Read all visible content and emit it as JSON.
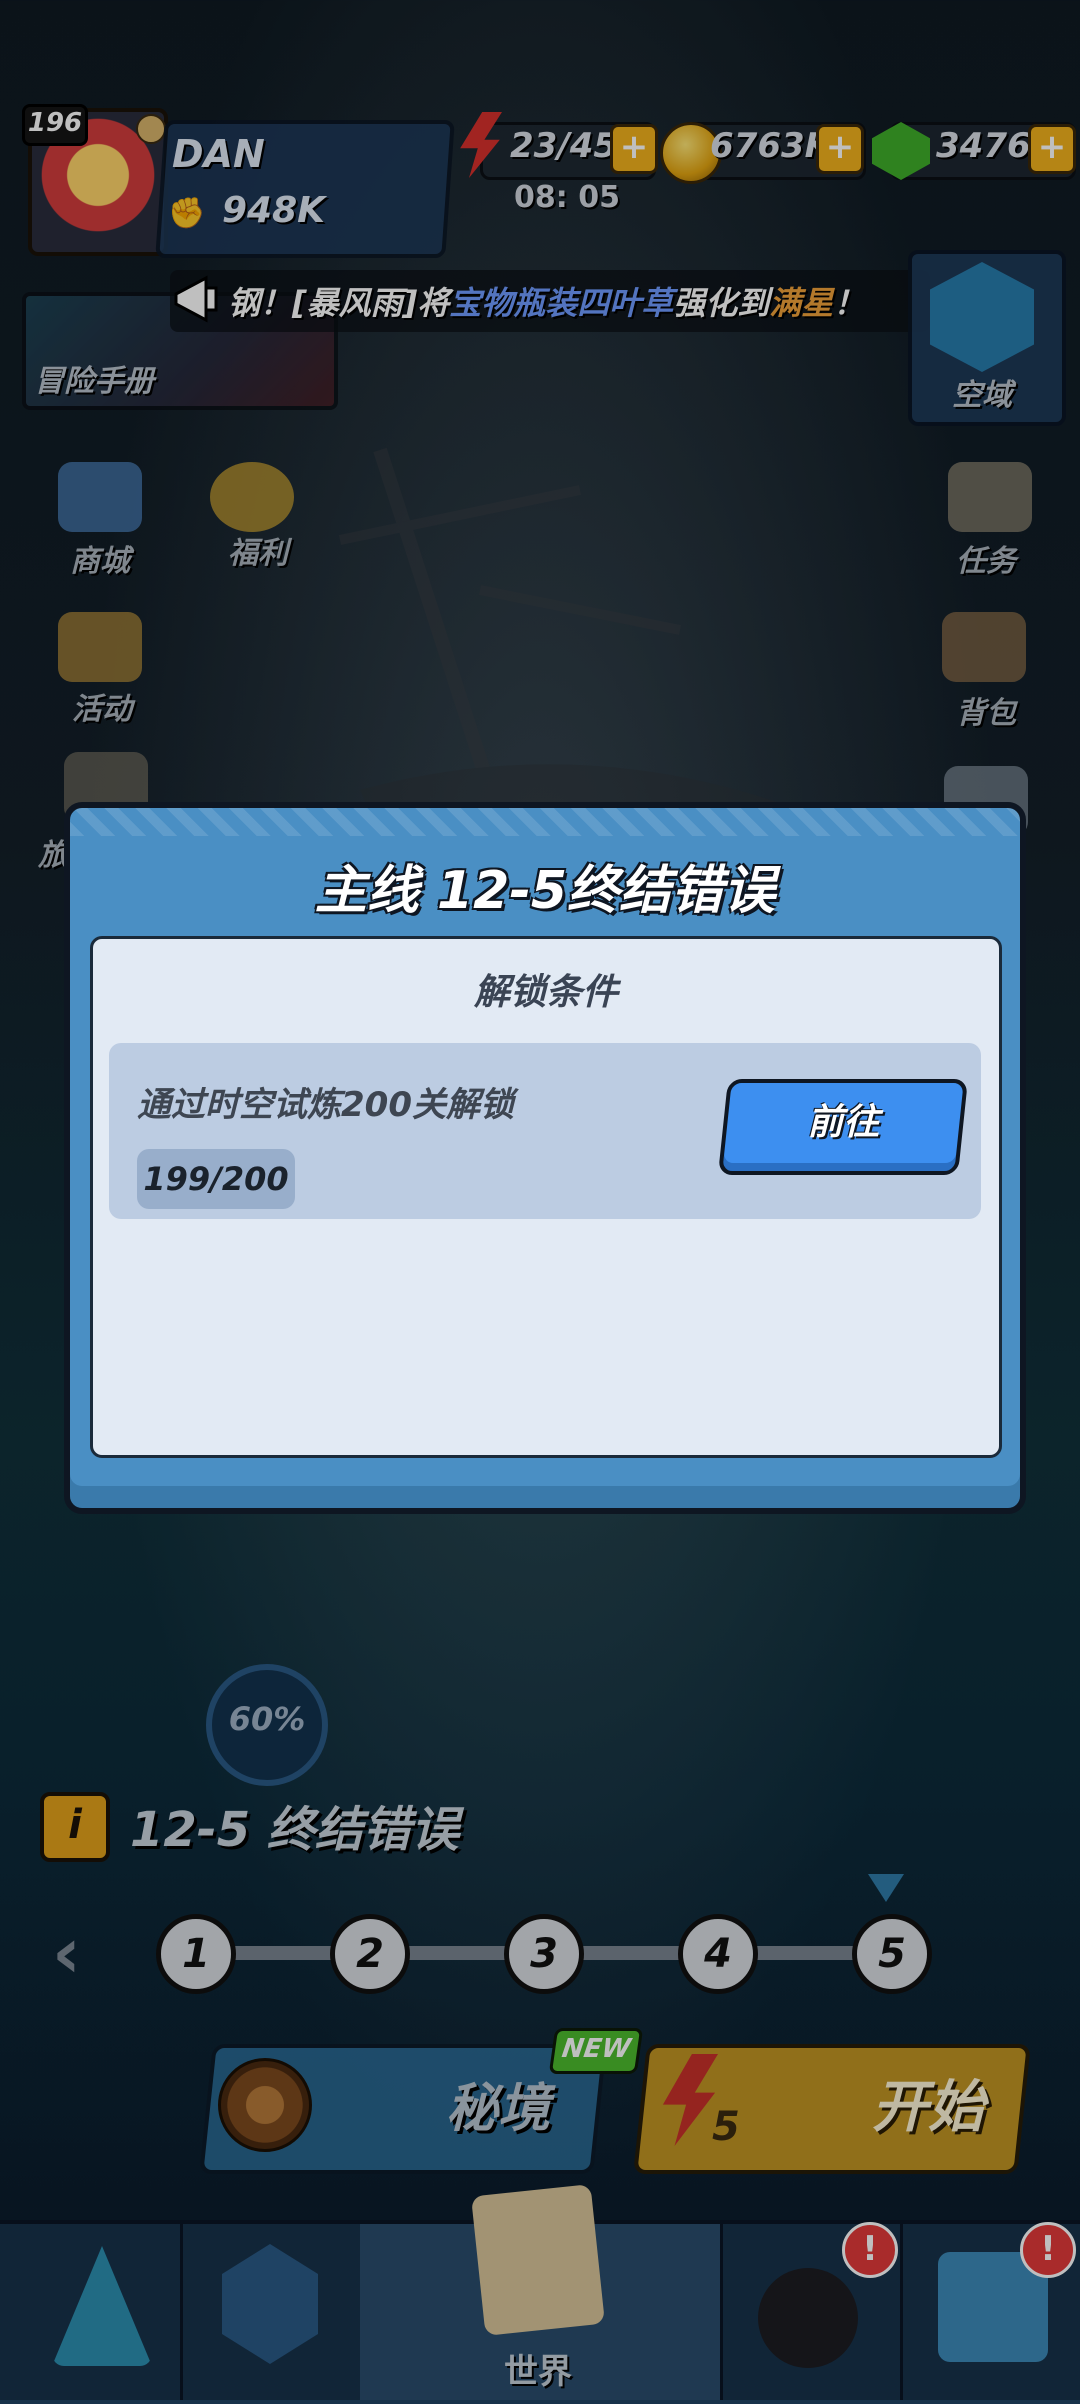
{
  "player": {
    "level": "196",
    "name": "DAN",
    "power": "948K"
  },
  "resources": {
    "energy": "23/45",
    "energy_timer": "08: 05",
    "coins": "6763K",
    "gems": "3476"
  },
  "ticker": {
    "segments": [
      "钢！[暴风雨]将",
      "宝物瓶装四叶草",
      "强化到",
      "满星",
      "！"
    ]
  },
  "left_menu": {
    "adventure_manual": "冒险手册",
    "shop": "商城",
    "welfare": "福利",
    "events": "活动",
    "partial": "旅"
  },
  "right_menu": {
    "sky_zone": "空域",
    "quests": "任务",
    "bag": "背包"
  },
  "modal": {
    "title": "主线 12-5终结错误",
    "section_title": "解锁条件",
    "condition_text": "通过时空试炼200关解锁",
    "progress": "199/200",
    "go_button": "前往"
  },
  "stage": {
    "completion": "60%",
    "name": "12-5 终结错误",
    "nodes": [
      "1",
      "2",
      "3",
      "4",
      "5"
    ]
  },
  "actions": {
    "secret_realm": "秘境",
    "new_badge": "NEW",
    "start": "开始",
    "start_cost": "5"
  },
  "bottom_nav": {
    "world_label": "世界",
    "alert_mark": "!"
  }
}
